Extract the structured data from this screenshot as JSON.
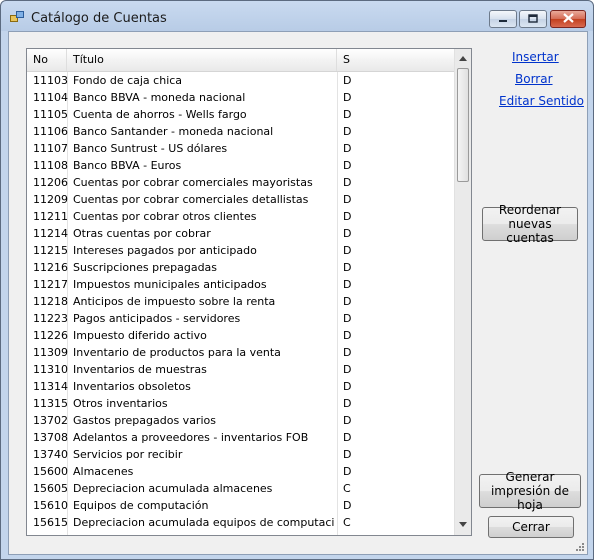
{
  "window": {
    "title": "Catálogo de Cuentas"
  },
  "grid": {
    "columns": [
      "No",
      "Título",
      "S"
    ],
    "rows": [
      {
        "no": "11103",
        "title": "Fondo de caja chica",
        "s": "D"
      },
      {
        "no": "11104",
        "title": "Banco BBVA - moneda nacional",
        "s": "D"
      },
      {
        "no": "11105",
        "title": "Cuenta de ahorros - Wells fargo",
        "s": "D"
      },
      {
        "no": "11106",
        "title": "Banco Santander - moneda nacional",
        "s": "D"
      },
      {
        "no": "11107",
        "title": "Banco Suntrust - US dólares",
        "s": "D"
      },
      {
        "no": "11108",
        "title": "Banco BBVA - Euros",
        "s": "D"
      },
      {
        "no": "11206",
        "title": "Cuentas por cobrar comerciales mayoristas",
        "s": "D"
      },
      {
        "no": "11209",
        "title": "Cuentas por cobrar comerciales detallistas",
        "s": "D"
      },
      {
        "no": "11211",
        "title": "Cuentas por cobrar otros clientes",
        "s": "D"
      },
      {
        "no": "11214",
        "title": "Otras cuentas por cobrar",
        "s": "D"
      },
      {
        "no": "11215",
        "title": "Intereses pagados por anticipado",
        "s": "D"
      },
      {
        "no": "11216",
        "title": "Suscripciones prepagadas",
        "s": "D"
      },
      {
        "no": "11217",
        "title": "Impuestos municipales anticipados",
        "s": "D"
      },
      {
        "no": "11218",
        "title": "Anticipos de impuesto sobre la renta",
        "s": "D"
      },
      {
        "no": "11223",
        "title": "Pagos anticipados - servidores",
        "s": "D"
      },
      {
        "no": "11226",
        "title": "Impuesto diferido activo",
        "s": "D"
      },
      {
        "no": "11309",
        "title": "Inventario de productos para la venta",
        "s": "D"
      },
      {
        "no": "11310",
        "title": "Inventarios de muestras",
        "s": "D"
      },
      {
        "no": "11314",
        "title": "Inventarios obsoletos",
        "s": "D"
      },
      {
        "no": "11315",
        "title": "Otros inventarios",
        "s": "D"
      },
      {
        "no": "13702",
        "title": "Gastos prepagados varios",
        "s": "D"
      },
      {
        "no": "13708",
        "title": "Adelantos a proveedores - inventarios FOB",
        "s": "D"
      },
      {
        "no": "13740",
        "title": "Servicios por recibir",
        "s": "D"
      },
      {
        "no": "15600",
        "title": "Almacenes",
        "s": "D"
      },
      {
        "no": "15605",
        "title": "Depreciacion acumulada almacenes",
        "s": "C"
      },
      {
        "no": "15610",
        "title": "Equipos de computación",
        "s": "D"
      },
      {
        "no": "15615",
        "title": "Depreciacion acumulada equipos de computación",
        "s": "C"
      }
    ]
  },
  "actions": {
    "insert": "Insertar",
    "delete": "Borrar",
    "edit_sense": "Editar Sentido",
    "reorder_line1": "Reordenar",
    "reorder_line2": "nuevas cuentas",
    "print_line1": "Generar",
    "print_line2": "impresión de hoja",
    "close": "Cerrar"
  },
  "icons": {
    "app": "app-window-icon",
    "minimize": "minimize-icon",
    "maximize": "maximize-icon",
    "close": "close-icon",
    "scroll_up": "scroll-up-arrow-icon",
    "scroll_down": "scroll-down-arrow-icon",
    "resize": "resize-grip-icon"
  },
  "colors": {
    "link": "#0033cc",
    "close_button": "#c2401f"
  }
}
